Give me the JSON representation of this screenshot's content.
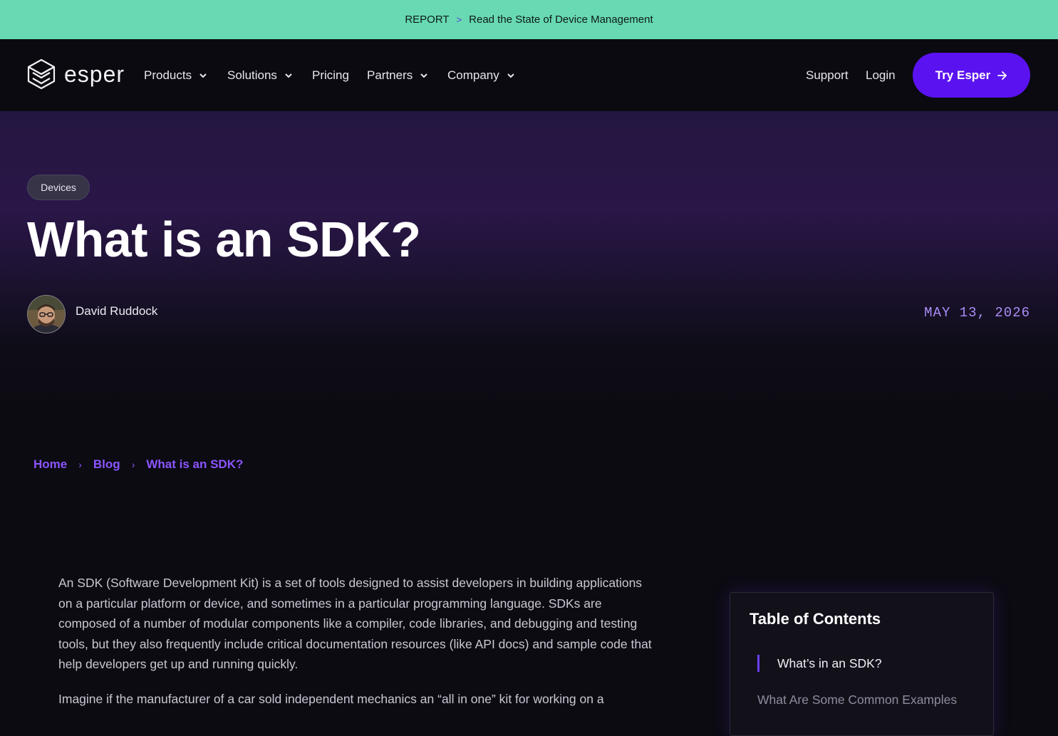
{
  "banner": {
    "tag": "REPORT",
    "separator": ">",
    "text": "Read the State of Device Management"
  },
  "nav": {
    "logo_text": "esper",
    "items": [
      {
        "label": "Products",
        "has_dropdown": true
      },
      {
        "label": "Solutions",
        "has_dropdown": true
      },
      {
        "label": "Pricing",
        "has_dropdown": false
      },
      {
        "label": "Partners",
        "has_dropdown": true
      },
      {
        "label": "Company",
        "has_dropdown": true
      }
    ],
    "support": "Support",
    "login": "Login",
    "cta": "Try Esper"
  },
  "hero": {
    "tag": "Devices",
    "title": "What is an SDK?",
    "author": "David Ruddock",
    "date": "MAY 13, 2026"
  },
  "breadcrumb": [
    "Home",
    "Blog",
    "What is an SDK?"
  ],
  "article": {
    "paragraphs": [
      "An SDK (Software Development Kit) is a set of tools designed to assist developers in building applications on a particular platform or device, and sometimes in a particular programming language. SDKs are composed of a number of modular components like a compiler, code libraries, and debugging and testing tools, but they also frequently include critical documentation resources (like API docs) and sample code that help developers get up and running quickly.",
      "Imagine if the manufacturer of a car sold independent mechanics an “all in one” kit for working on a"
    ]
  },
  "toc": {
    "title": "Table of Contents",
    "items": [
      "What’s in an SDK?",
      "What Are Some Common Examples"
    ]
  },
  "colors": {
    "banner": "#68d9b3",
    "accent": "#5b12f0",
    "link": "#8b55ff",
    "date": "#a98cf8"
  }
}
